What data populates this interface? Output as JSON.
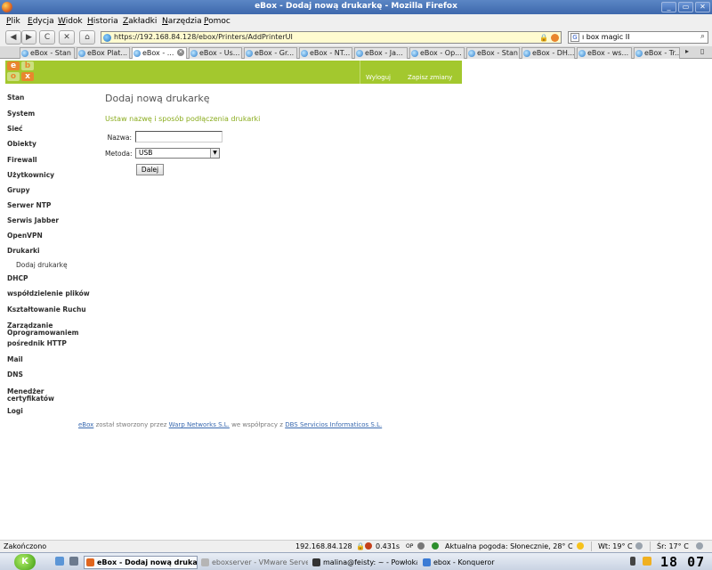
{
  "window": {
    "title": "eBox - Dodaj nową drukarkę - Mozilla Firefox",
    "controls": [
      "_",
      "▭",
      "✕"
    ]
  },
  "menu": [
    "Plik",
    "Edycja",
    "Widok",
    "Historia",
    "Zakładki",
    "Narzędzia",
    "Pomoc"
  ],
  "toolbar": {
    "back": "◀",
    "forward": "▶",
    "reload": "C",
    "stop": "✕",
    "home": "⌂",
    "url": "https://192.168.84.128/ebox/Printers/AddPrinterUI",
    "search_engine": "G",
    "search_value": "ı box magic II"
  },
  "tabs": [
    "eBox - Stan",
    "eBox Plat...",
    "eBox - ...",
    "eBox - Us...",
    "eBox - Gr...",
    "eBox - NT...",
    "eBox - Ja...",
    "eBox - Op...",
    "eBox - Stan",
    "eBox - DH...",
    "eBox - ws...",
    "eBox - Tr..."
  ],
  "tabbar": {
    "scroll": "▸",
    "new": "▯"
  },
  "header": {
    "logo_letters": [
      "e",
      "b",
      "o",
      "x"
    ],
    "logout": "Wyloguj",
    "save_changes": "Zapisz zmiany"
  },
  "sidebar": [
    {
      "label": "Stan",
      "sub": false
    },
    {
      "label": "System",
      "sub": false
    },
    {
      "label": "Sieć",
      "sub": false
    },
    {
      "label": "Obiekty",
      "sub": false
    },
    {
      "label": "Firewall",
      "sub": false
    },
    {
      "label": "Użytkownicy",
      "sub": false
    },
    {
      "label": "Grupy",
      "sub": false
    },
    {
      "label": "Serwer NTP",
      "sub": false
    },
    {
      "label": "Serwis Jabber",
      "sub": false
    },
    {
      "label": "OpenVPN",
      "sub": false
    },
    {
      "label": "Drukarki",
      "sub": false
    },
    {
      "label": "Dodaj drukarkę",
      "sub": true
    },
    {
      "label": "DHCP",
      "sub": false
    },
    {
      "label": "współdzielenie plików",
      "sub": false
    },
    {
      "label": "Kształtowanie Ruchu",
      "sub": false
    },
    {
      "label": "Zarządzanie Oprogramowaniem",
      "sub": false
    },
    {
      "label": "pośrednik HTTP",
      "sub": false
    },
    {
      "label": "Mail",
      "sub": false
    },
    {
      "label": "DNS",
      "sub": false
    },
    {
      "label": "Menedżer certyfikatów",
      "sub": false
    },
    {
      "label": "Logi",
      "sub": false
    }
  ],
  "main": {
    "title": "Dodaj nową drukarkę",
    "subtitle": "Ustaw nazwę i sposób podłączenia drukarki",
    "name_label": "Nazwa:",
    "name_value": "",
    "method_label": "Metoda:",
    "method_value": "USB",
    "next_button": "Dalej"
  },
  "footer": {
    "ebox": "eBox",
    "text1": "został stworzony przez",
    "warp": "Warp Networks S.L.",
    "text2": "we współpracy z",
    "dbs": "DBS Servicios Informaticos S.L."
  },
  "statusbar": {
    "status": "Zakończono",
    "ip": "192.168.84.128",
    "time": "0.431s",
    "op": "OP",
    "weather": "Aktualna pogoda: Słonecznie, 28° C",
    "wt": "Wt: 19° C",
    "sr": "Śr: 17° C"
  },
  "taskbar": {
    "k": "K",
    "tasks": [
      {
        "label": "eBox - Dodaj nową drukarkę",
        "active": true
      },
      {
        "label": "eboxserver - VMware Server",
        "active": false
      },
      {
        "label": "malina@feisty: ~ - Powłoka",
        "active": false
      },
      {
        "label": "ebox - Konqueror",
        "active": false
      }
    ],
    "clock": "18 07"
  }
}
